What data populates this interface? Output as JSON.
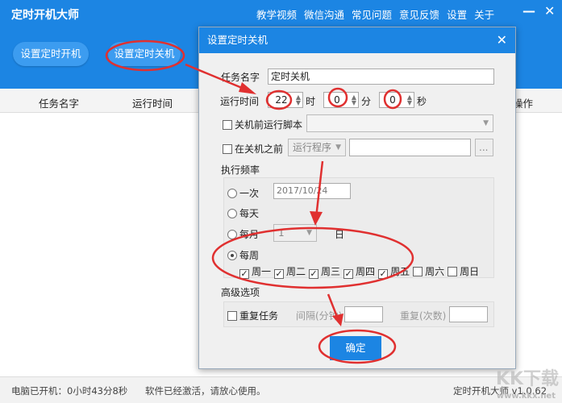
{
  "app": {
    "title": "定时开机大师",
    "menu": [
      "教学视频",
      "微信沟通",
      "常见问题",
      "意见反馈",
      "设置",
      "关于"
    ],
    "minimize": "—",
    "close": "✕"
  },
  "toolbar": {
    "set_boot": "设置定时开机",
    "set_shutdown": "设置定时关机"
  },
  "table": {
    "headers": [
      "任务名字",
      "运行时间",
      "操作"
    ]
  },
  "status": {
    "uptime": "电脑已开机：0小时43分8秒",
    "activation": "软件已经激活，请放心使用。",
    "version": "定时开机大师 v1.0.62"
  },
  "watermark": {
    "logo": "KK下载",
    "url": "www.kkx.net"
  },
  "dialog": {
    "title": "设置定时关机",
    "close": "✕",
    "task_name_label": "任务名字",
    "task_name": "定时关机",
    "run_time_label": "运行时间",
    "hour": "22",
    "hour_unit": "时",
    "minute": "0",
    "minute_unit": "分",
    "second": "0",
    "second_unit": "秒",
    "script_label": "关机前运行脚本",
    "before_label": "在关机之前",
    "run_program": "运行程序",
    "browse": "...",
    "freq_label": "执行频率",
    "once": "一次",
    "once_date": "2017/10/24",
    "daily": "每天",
    "monthly": "每月",
    "month_day": "1",
    "day_unit": "日",
    "weekly": "每周",
    "weekdays": [
      {
        "label": "周一",
        "checked": true
      },
      {
        "label": "周二",
        "checked": true
      },
      {
        "label": "周三",
        "checked": true
      },
      {
        "label": "周四",
        "checked": true
      },
      {
        "label": "周五",
        "checked": true
      },
      {
        "label": "周六",
        "checked": false
      },
      {
        "label": "周日",
        "checked": false
      }
    ],
    "advanced_label": "高级选项",
    "repeat_task": "重复任务",
    "interval_label": "间隔(分钟)",
    "repeat_count_label": "重复(次数)",
    "ok": "确定"
  },
  "annotation_color": "#e03030"
}
